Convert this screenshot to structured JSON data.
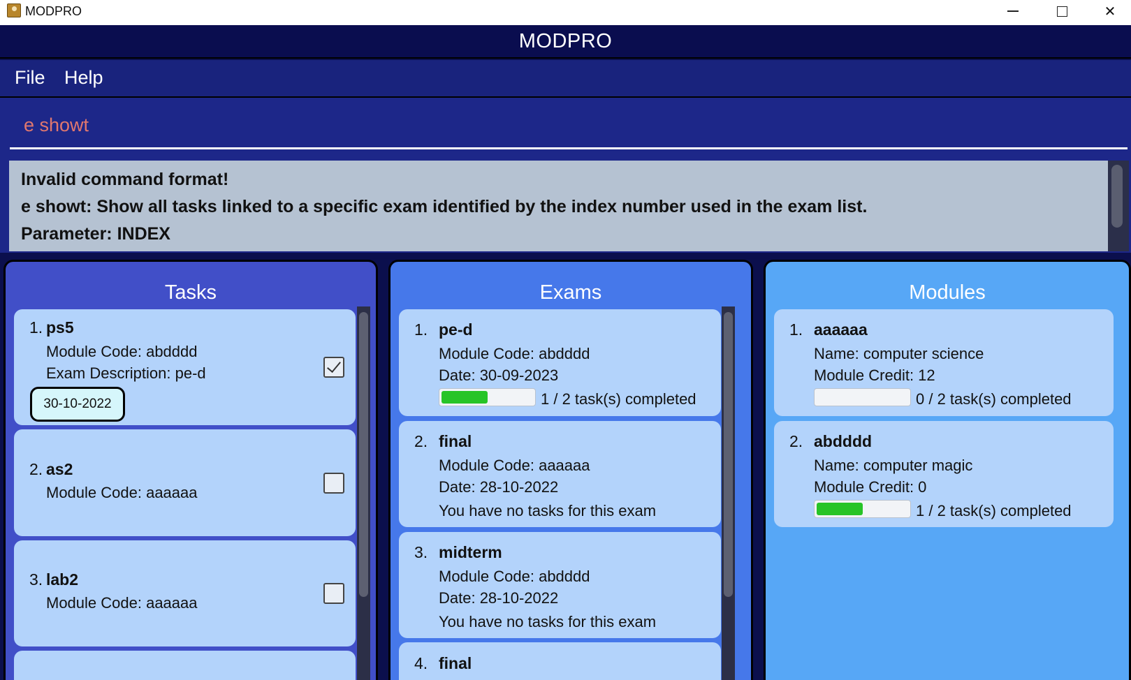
{
  "window": {
    "title": "MODPRO",
    "minimize": "minimize",
    "maximize": "maximize",
    "close": "close"
  },
  "header": {
    "title": "MODPRO"
  },
  "menu": {
    "file": "File",
    "help": "Help"
  },
  "command": {
    "value": "e showt"
  },
  "result": {
    "line1": "Invalid command format!",
    "line2": "e showt: Show all tasks linked to a specific exam identified by the index number used in the exam list.",
    "line3": "Parameter: INDEX"
  },
  "tasks": {
    "title": "Tasks",
    "items": [
      {
        "index": "1.",
        "name": "ps5",
        "module": "Module Code: abdddd",
        "exam": "Exam Description: pe-d",
        "date": "30-10-2022",
        "done": true
      },
      {
        "index": "2.",
        "name": "as2",
        "module": "Module Code: aaaaaa",
        "done": false
      },
      {
        "index": "3.",
        "name": "lab2",
        "module": "Module Code: aaaaaa",
        "done": false
      }
    ]
  },
  "exams": {
    "title": "Exams",
    "items": [
      {
        "index": "1.",
        "name": "pe-d",
        "module": "Module Code: abdddd",
        "date": "Date: 30-09-2023",
        "progress_text": "1 / 2 task(s) completed",
        "progress": 0.5
      },
      {
        "index": "2.",
        "name": "final",
        "module": "Module Code: aaaaaa",
        "date": "Date: 28-10-2022",
        "status": "You have no tasks for this exam"
      },
      {
        "index": "3.",
        "name": "midterm",
        "module": "Module Code: abdddd",
        "date": "Date: 28-10-2022",
        "status": "You have no tasks for this exam"
      },
      {
        "index": "4.",
        "name": "final"
      }
    ]
  },
  "modules": {
    "title": "Modules",
    "items": [
      {
        "index": "1.",
        "code": "aaaaaa",
        "name": "Name: computer science",
        "credit": "Module Credit: 12",
        "progress_text": "0 / 2 task(s) completed",
        "progress": 0
      },
      {
        "index": "2.",
        "code": "abdddd",
        "name": "Name: computer magic",
        "credit": "Module Credit: 0",
        "progress_text": "1 / 2 task(s) completed",
        "progress": 0.5
      }
    ]
  },
  "colors": {
    "accent": "#19237d",
    "progress_fill": "#27c427",
    "command_text": "#e0776e"
  }
}
